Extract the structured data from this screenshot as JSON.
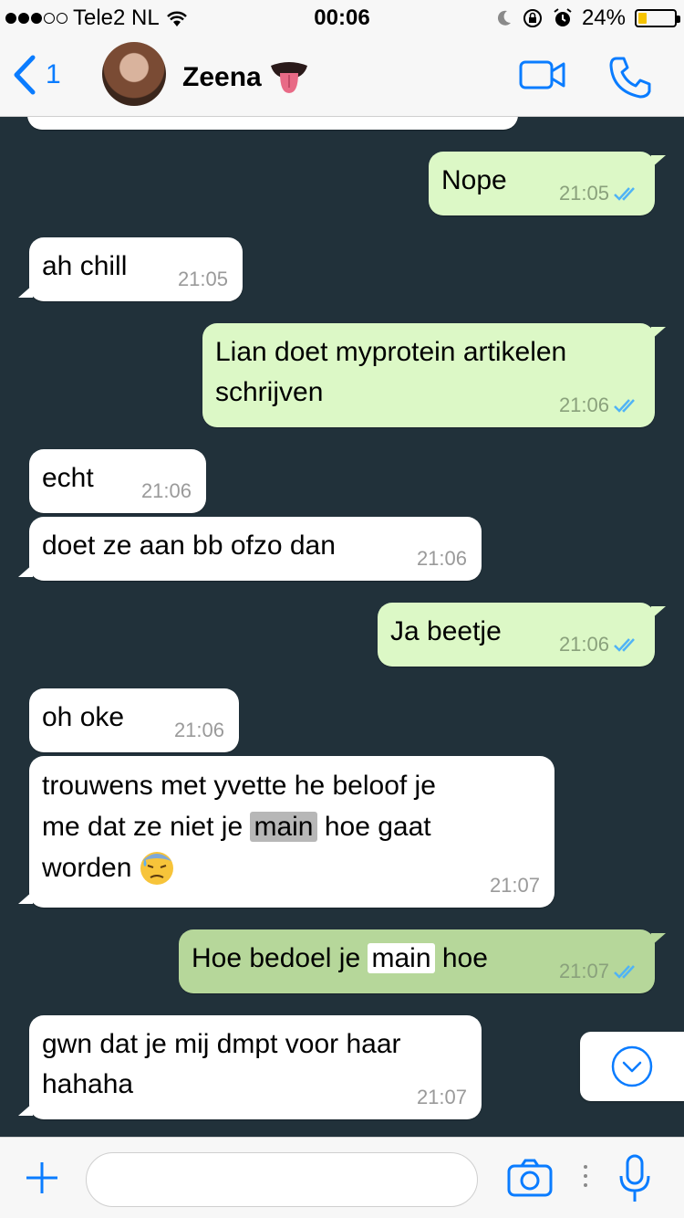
{
  "status_bar": {
    "carrier": "Tele2 NL",
    "time": "00:06",
    "battery_percent": "24%",
    "battery_level": 0.24,
    "signal_bars_filled": 3,
    "signal_bars_total": 5
  },
  "nav": {
    "back_count": "1",
    "contact_name": "Zeena",
    "name_emoji": "tongue-out-emoji"
  },
  "messages": [
    {
      "dir": "out",
      "text": "Nope",
      "time": "21:05"
    },
    {
      "dir": "in",
      "text": "ah chill",
      "time": "21:05"
    },
    {
      "dir": "out",
      "line1": "Lian doet myprotein artikelen",
      "line2": "schrijven",
      "time": "21:06"
    },
    {
      "dir": "in",
      "text": "echt",
      "time": "21:06"
    },
    {
      "dir": "in",
      "text": "doet ze aan bb ofzo dan",
      "time": "21:06"
    },
    {
      "dir": "out",
      "text": "Ja beetje",
      "time": "21:06"
    },
    {
      "dir": "in",
      "text": "oh oke",
      "time": "21:06"
    },
    {
      "dir": "in",
      "line1": "trouwens met yvette he beloof je",
      "line2a": "me dat ze niet je ",
      "line2_highlight": "main",
      "line2b": " hoe gaat",
      "line3": "worden",
      "emoji": "downcast-sweat-emoji",
      "time": "21:07"
    },
    {
      "dir": "out",
      "before": "Hoe bedoel je ",
      "highlight": "main",
      "after": " hoe",
      "time": "21:07"
    },
    {
      "dir": "in",
      "line1": "gwn dat je mij dmpt voor haar",
      "line2": "hahaha",
      "time": "21:07"
    }
  ],
  "input": {
    "placeholder": ""
  },
  "colors": {
    "accent": "#0a7cff",
    "chat_bg": "#21313a",
    "out_bubble": "#dcf8c6",
    "in_bubble": "#ffffff",
    "read_ticks": "#4fb3f6"
  }
}
